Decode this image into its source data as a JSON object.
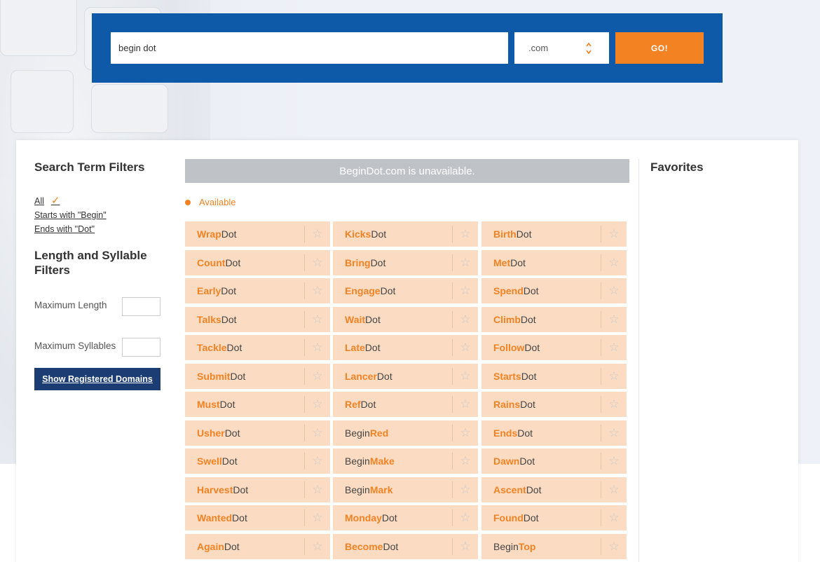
{
  "search": {
    "query": "begin dot",
    "tld": ".com",
    "go_label": "GO!"
  },
  "sidebar": {
    "search_filters_title": "Search Term Filters",
    "filters": [
      "All",
      "Starts with \"Begin\"",
      "Ends with \"Dot\""
    ],
    "check_glyph": "✓",
    "length_filters_title": "Length and Syllable Filters",
    "max_length_label": "Maximum Length",
    "max_syllables_label": "Maximum Syllables",
    "show_registered_label": "Show Registered Domains"
  },
  "results": {
    "unavailable_message": "BeginDot.com is unavailable.",
    "legend_available": "Available",
    "columns": [
      [
        {
          "highlight": "Wrap",
          "rest": "Dot",
          "order": "hl-first"
        },
        {
          "highlight": "Count",
          "rest": "Dot",
          "order": "hl-first"
        },
        {
          "highlight": "Early",
          "rest": "Dot",
          "order": "hl-first"
        },
        {
          "highlight": "Talks",
          "rest": "Dot",
          "order": "hl-first"
        },
        {
          "highlight": "Tackle",
          "rest": "Dot",
          "order": "hl-first"
        },
        {
          "highlight": "Submit",
          "rest": "Dot",
          "order": "hl-first"
        },
        {
          "highlight": "Must",
          "rest": "Dot",
          "order": "hl-first"
        },
        {
          "highlight": "Usher",
          "rest": "Dot",
          "order": "hl-first"
        },
        {
          "highlight": "Swell",
          "rest": "Dot",
          "order": "hl-first"
        },
        {
          "highlight": "Harvest",
          "rest": "Dot",
          "order": "hl-first"
        },
        {
          "highlight": "Wanted",
          "rest": "Dot",
          "order": "hl-first"
        },
        {
          "highlight": "Again",
          "rest": "Dot",
          "order": "hl-first"
        }
      ],
      [
        {
          "highlight": "Kicks",
          "rest": "Dot",
          "order": "hl-first"
        },
        {
          "highlight": "Bring",
          "rest": "Dot",
          "order": "hl-first"
        },
        {
          "highlight": "Engage",
          "rest": "Dot",
          "order": "hl-first"
        },
        {
          "highlight": "Wait",
          "rest": "Dot",
          "order": "hl-first"
        },
        {
          "highlight": "Late",
          "rest": "Dot",
          "order": "hl-first"
        },
        {
          "highlight": "Lancer",
          "rest": "Dot",
          "order": "hl-first"
        },
        {
          "highlight": "Ref",
          "rest": "Dot",
          "order": "hl-first"
        },
        {
          "highlight": "Red",
          "rest": "Begin",
          "order": "hl-last"
        },
        {
          "highlight": "Make",
          "rest": "Begin",
          "order": "hl-last"
        },
        {
          "highlight": "Mark",
          "rest": "Begin",
          "order": "hl-last"
        },
        {
          "highlight": "Monday",
          "rest": "Dot",
          "order": "hl-first"
        },
        {
          "highlight": "Become",
          "rest": "Dot",
          "order": "hl-first"
        }
      ],
      [
        {
          "highlight": "Birth",
          "rest": "Dot",
          "order": "hl-first"
        },
        {
          "highlight": "Met",
          "rest": "Dot",
          "order": "hl-first"
        },
        {
          "highlight": "Spend",
          "rest": "Dot",
          "order": "hl-first"
        },
        {
          "highlight": "Climb",
          "rest": "Dot",
          "order": "hl-first"
        },
        {
          "highlight": "Follow",
          "rest": "Dot",
          "order": "hl-first"
        },
        {
          "highlight": "Starts",
          "rest": "Dot",
          "order": "hl-first"
        },
        {
          "highlight": "Rains",
          "rest": "Dot",
          "order": "hl-first"
        },
        {
          "highlight": "Ends",
          "rest": "Dot",
          "order": "hl-first"
        },
        {
          "highlight": "Dawn",
          "rest": "Dot",
          "order": "hl-first"
        },
        {
          "highlight": "Ascent",
          "rest": "Dot",
          "order": "hl-first"
        },
        {
          "highlight": "Found",
          "rest": "Dot",
          "order": "hl-first"
        },
        {
          "highlight": "Top",
          "rest": "Begin",
          "order": "hl-last"
        }
      ]
    ],
    "star_glyph": "☆"
  },
  "favorites": {
    "title": "Favorites"
  },
  "colors": {
    "brand_blue": "#0f5aa8",
    "accent_orange": "#f28222",
    "tile_bg": "#fbdcc3",
    "navy_button": "#1b3d73",
    "unavailable_bg": "#bfc3c8"
  }
}
